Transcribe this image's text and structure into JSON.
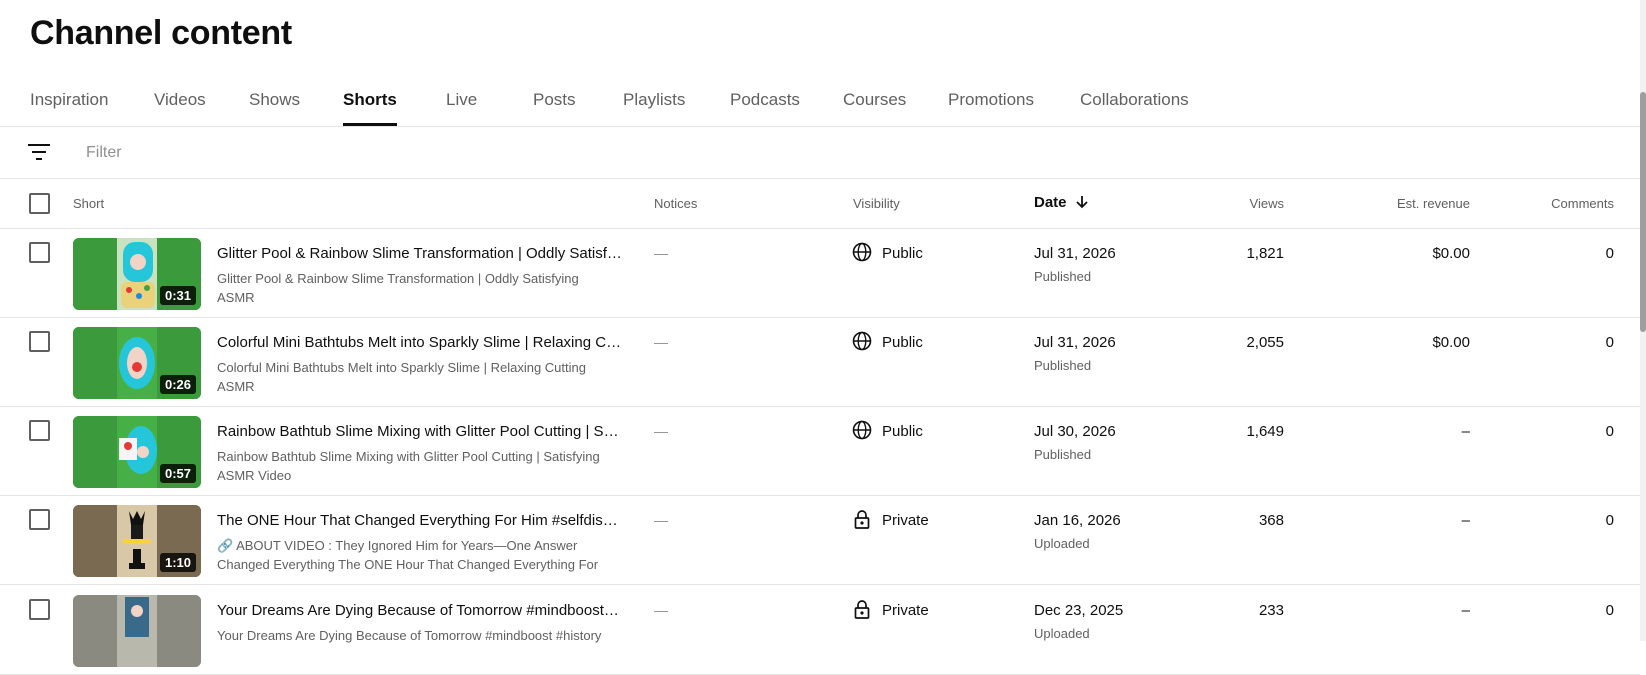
{
  "page": {
    "title": "Channel content"
  },
  "tabs": [
    {
      "label": "Inspiration"
    },
    {
      "label": "Videos"
    },
    {
      "label": "Shows"
    },
    {
      "label": "Shorts",
      "active": true
    },
    {
      "label": "Live"
    },
    {
      "label": "Posts"
    },
    {
      "label": "Playlists"
    },
    {
      "label": "Podcasts"
    },
    {
      "label": "Courses"
    },
    {
      "label": "Promotions"
    },
    {
      "label": "Collaborations"
    }
  ],
  "filter": {
    "placeholder": "Filter",
    "icon": "filter-icon"
  },
  "columns": {
    "short": "Short",
    "notices": "Notices",
    "visibility": "Visibility",
    "date": "Date",
    "views": "Views",
    "revenue": "Est. revenue",
    "comments": "Comments"
  },
  "rows": [
    {
      "duration": "0:31",
      "title": "Glitter Pool & Rainbow Slime Transformation | Oddly Satisfying ASMR",
      "description": "Glitter Pool & Rainbow Slime Transformation | Oddly Satisfying ASMR",
      "notice": "—",
      "visibility": "Public",
      "visibility_icon": "globe-icon",
      "date": "Jul 31, 2026",
      "date_status": "Published",
      "views": "1,821",
      "revenue": "$0.00",
      "comments": "0"
    },
    {
      "duration": "0:26",
      "title": "Colorful Mini Bathtubs Melt into Sparkly Slime | Relaxing Cutting ASMR",
      "description": "Colorful Mini Bathtubs Melt into Sparkly Slime | Relaxing Cutting ASMR",
      "notice": "—",
      "visibility": "Public",
      "visibility_icon": "globe-icon",
      "date": "Jul 31, 2026",
      "date_status": "Published",
      "views": "2,055",
      "revenue": "$0.00",
      "comments": "0"
    },
    {
      "duration": "0:57",
      "title": "Rainbow Bathtub Slime Mixing with Glitter Pool Cutting | Satisfying ASMR Video",
      "description": "Rainbow Bathtub Slime Mixing with Glitter Pool Cutting | Satisfying ASMR Video",
      "notice": "—",
      "visibility": "Public",
      "visibility_icon": "globe-icon",
      "date": "Jul 30, 2026",
      "date_status": "Published",
      "views": "1,649",
      "revenue": "–",
      "comments": "0"
    },
    {
      "duration": "1:10",
      "title": "The ONE Hour That Changed Everything For Him #selfdiscipline",
      "description": "🔗 ABOUT VIDEO : They Ignored Him for Years—One Answer Changed Everything The ONE Hour That Changed Everything For Him...",
      "notice": "—",
      "visibility": "Private",
      "visibility_icon": "lock-icon",
      "date": "Jan 16, 2026",
      "date_status": "Uploaded",
      "views": "368",
      "revenue": "–",
      "comments": "0"
    },
    {
      "duration": "",
      "title": "Your Dreams Are Dying Because of Tomorrow #mindboost #history",
      "description": "Your Dreams Are Dying Because of Tomorrow #mindboost #history",
      "notice": "—",
      "visibility": "Private",
      "visibility_icon": "lock-icon",
      "date": "Dec 23, 2025",
      "date_status": "Uploaded",
      "views": "233",
      "revenue": "–",
      "comments": "0"
    }
  ],
  "colors": {
    "text": "#0f0f0f",
    "secondary": "#606060",
    "divider": "#e5e5e5",
    "slime_green": "#2e7d32",
    "pool_teal": "#26c6da"
  }
}
